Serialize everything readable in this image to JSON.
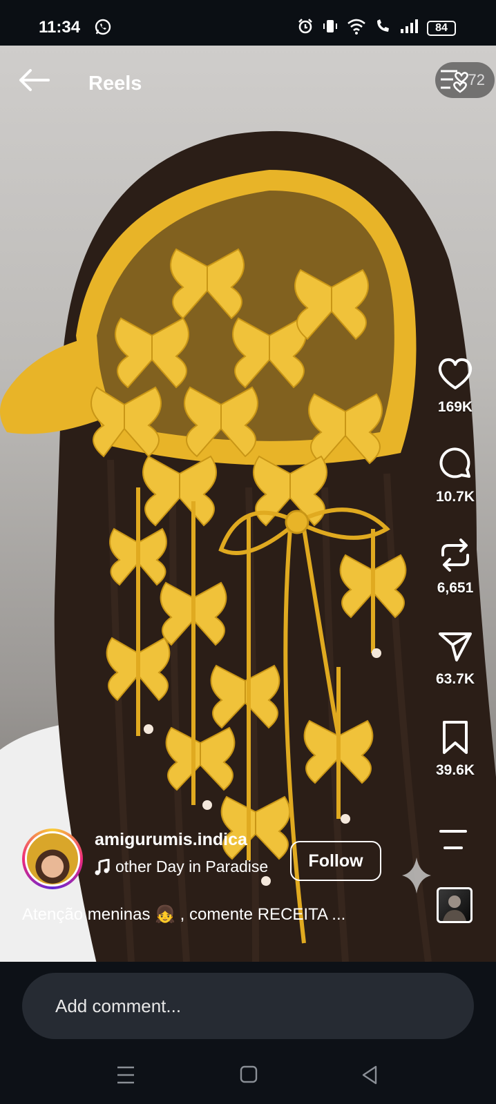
{
  "status_bar": {
    "time": "11:34",
    "battery": "84",
    "icons": [
      "whatsapp-icon",
      "alarm-icon",
      "vibrate-icon",
      "wifi-icon",
      "wifi-call-icon",
      "signal-icon",
      "battery-icon"
    ]
  },
  "header": {
    "title": "Reels",
    "counter": "72"
  },
  "actions": {
    "likes": "169K",
    "comments": "10.7K",
    "reposts": "6,651",
    "shares": "63.7K",
    "saves": "39.6K"
  },
  "post": {
    "username": "amigurumis.indica",
    "audio": "other Day in Paradise",
    "follow_label": "Follow",
    "caption": "Atenção meninas 👧 , comente RECEITA ..."
  },
  "comment": {
    "placeholder": "Add comment..."
  },
  "colors": {
    "background": "#0b0f14",
    "crochet_yellow": "#e8b428",
    "hair": "#2b1e17",
    "input_bg": "#262b33"
  }
}
